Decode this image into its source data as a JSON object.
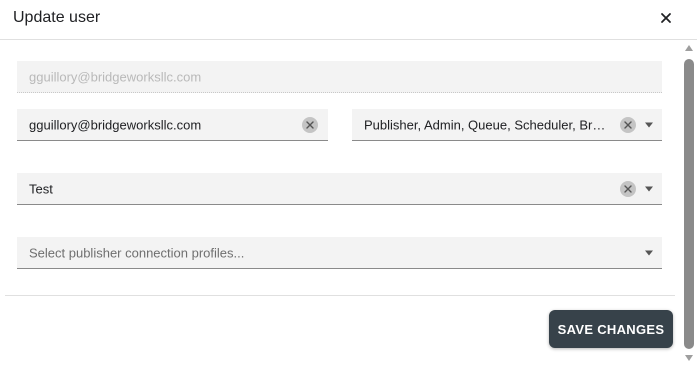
{
  "dialog": {
    "title": "Update user",
    "close_icon": "close-icon"
  },
  "form": {
    "username": {
      "value": "gguillory@bridgeworksllc.com"
    },
    "email": {
      "value": "gguillory@bridgeworksllc.com"
    },
    "roles": {
      "value": "Publisher, Admin, Queue, Scheduler, Bridgit ..."
    },
    "group": {
      "value": "Test"
    },
    "connection_profiles": {
      "placeholder": "Select publisher connection profiles..."
    }
  },
  "footer": {
    "save_label": "SAVE CHANGES"
  },
  "colors": {
    "save_button": "#37424a",
    "field_background": "#f3f3f3"
  }
}
